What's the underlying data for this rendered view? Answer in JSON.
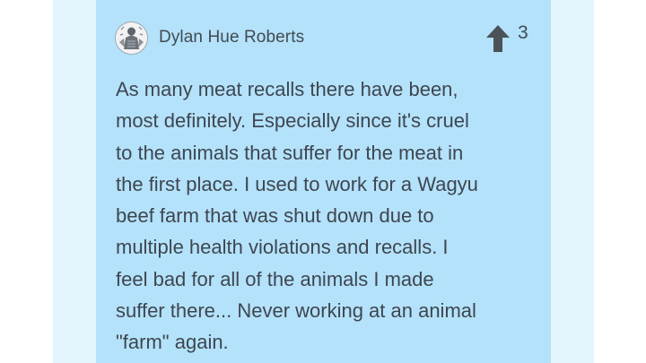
{
  "comment": {
    "author": "Dylan Hue Roberts",
    "avatar_icon": "engraving-avatar-icon",
    "upvote_icon": "arrow-up-icon",
    "vote_count": "3",
    "body_lines": [
      "As many meat recalls there have been,",
      "most definitely. Especially since it's cruel",
      "to the animals that suffer for the meat in",
      "the first place. I used to work for a Wagyu",
      "beef farm that was shut down due to",
      "multiple health violations and recalls. I",
      "feel bad for all of the animals I made",
      "suffer there... Never working at an animal",
      "\"farm\" again."
    ]
  },
  "colors": {
    "card_background": "#b4e2fb",
    "outer_background": "#e4f4fd",
    "text": "#3e4650",
    "upvote_arrow": "#4b5258"
  }
}
